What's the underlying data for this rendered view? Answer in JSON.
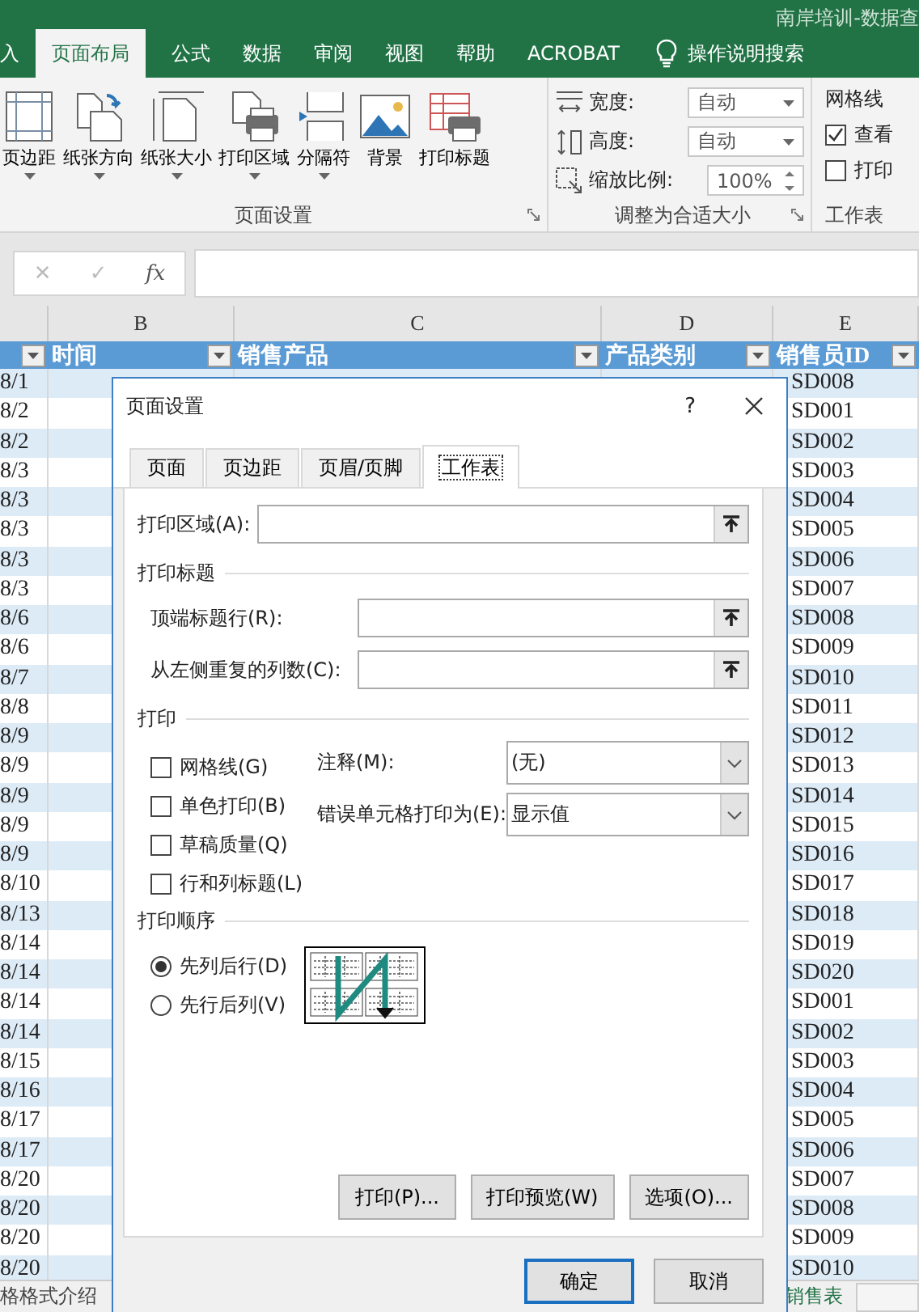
{
  "window": {
    "title": "南岸培训-数据查"
  },
  "ribbon_tabs": [
    {
      "label": "入",
      "selected": false
    },
    {
      "label": "页面布局",
      "selected": true
    },
    {
      "label": "公式",
      "selected": false
    },
    {
      "label": "数据",
      "selected": false
    },
    {
      "label": "审阅",
      "selected": false
    },
    {
      "label": "视图",
      "selected": false
    },
    {
      "label": "帮助",
      "selected": false
    },
    {
      "label": "ACROBAT",
      "selected": false
    }
  ],
  "tell_me": {
    "label": "操作说明搜索"
  },
  "page_setup_group": {
    "label": "页面设置",
    "buttons": [
      {
        "kind": "margins",
        "label": "页边距",
        "dropdown": true
      },
      {
        "kind": "orientation",
        "label": "纸张方向",
        "dropdown": true
      },
      {
        "kind": "size",
        "label": "纸张大小",
        "dropdown": true
      },
      {
        "kind": "print_area",
        "label": "打印区域",
        "dropdown": true
      },
      {
        "kind": "breaks",
        "label": "分隔符",
        "dropdown": true
      },
      {
        "kind": "background",
        "label": "背景",
        "dropdown": false
      },
      {
        "kind": "print_titles",
        "label": "打印标题",
        "dropdown": false
      }
    ]
  },
  "scale_group": {
    "label": "调整为合适大小",
    "rows": [
      {
        "kind": "width",
        "label": "宽度:",
        "value": "自动"
      },
      {
        "kind": "height",
        "label": "高度:",
        "value": "自动"
      },
      {
        "kind": "scale",
        "label": "缩放比例:",
        "value": "100%"
      }
    ]
  },
  "sheet_options_group": {
    "label": "工作表",
    "gridlines": {
      "title": "网格线",
      "options": [
        {
          "label": "查看",
          "checked": true
        },
        {
          "label": "打印",
          "checked": false
        }
      ]
    }
  },
  "formula_bar": {
    "cancel": "✕",
    "enter": "✓",
    "function": "fx"
  },
  "sheet": {
    "column_letters": [
      "B",
      "C",
      "D",
      "E"
    ],
    "headers": [
      "时间",
      "销售产品",
      "产品类别",
      "销售员ID"
    ],
    "rows": [
      {
        "column_a": "8/1",
        "salesperson_id": "SD008"
      },
      {
        "column_a": "8/2",
        "salesperson_id": "SD001"
      },
      {
        "column_a": "8/2",
        "salesperson_id": "SD002"
      },
      {
        "column_a": "8/3",
        "salesperson_id": "SD003"
      },
      {
        "column_a": "8/3",
        "salesperson_id": "SD004"
      },
      {
        "column_a": "8/3",
        "salesperson_id": "SD005"
      },
      {
        "column_a": "8/3",
        "salesperson_id": "SD006"
      },
      {
        "column_a": "8/3",
        "salesperson_id": "SD007"
      },
      {
        "column_a": "8/6",
        "salesperson_id": "SD008"
      },
      {
        "column_a": "8/6",
        "salesperson_id": "SD009"
      },
      {
        "column_a": "8/7",
        "salesperson_id": "SD010"
      },
      {
        "column_a": "8/8",
        "salesperson_id": "SD011"
      },
      {
        "column_a": "8/9",
        "salesperson_id": "SD012"
      },
      {
        "column_a": "8/9",
        "salesperson_id": "SD013"
      },
      {
        "column_a": "8/9",
        "salesperson_id": "SD014"
      },
      {
        "column_a": "8/9",
        "salesperson_id": "SD015"
      },
      {
        "column_a": "8/9",
        "salesperson_id": "SD016"
      },
      {
        "column_a": "8/10",
        "salesperson_id": "SD017"
      },
      {
        "column_a": "8/13",
        "salesperson_id": "SD018"
      },
      {
        "column_a": "8/14",
        "salesperson_id": "SD019"
      },
      {
        "column_a": "8/14",
        "salesperson_id": "SD020"
      },
      {
        "column_a": "8/14",
        "salesperson_id": "SD001"
      },
      {
        "column_a": "8/14",
        "salesperson_id": "SD002"
      },
      {
        "column_a": "8/15",
        "salesperson_id": "SD003"
      },
      {
        "column_a": "8/16",
        "salesperson_id": "SD004"
      },
      {
        "column_a": "8/17",
        "salesperson_id": "SD005"
      },
      {
        "column_a": "8/17",
        "salesperson_id": "SD006"
      },
      {
        "column_a": "8/20",
        "salesperson_id": "SD007"
      },
      {
        "column_a": "8/20",
        "salesperson_id": "SD008"
      },
      {
        "column_a": "8/20",
        "salesperson_id": "SD009"
      },
      {
        "column_a": "8/20",
        "salesperson_id": "SD010"
      }
    ]
  },
  "sheet_tabs": [
    {
      "label": "格格式介绍",
      "selected": false
    },
    {
      "label": "销售表",
      "selected": true
    }
  ],
  "dialog": {
    "title": "页面设置",
    "help": "?",
    "tabs": [
      {
        "label": "页面",
        "selected": false
      },
      {
        "label": "页边距",
        "selected": false
      },
      {
        "label": "页眉/页脚",
        "selected": false
      },
      {
        "label": "工作表",
        "selected": true
      }
    ],
    "print_area": {
      "label": "打印区域(A):"
    },
    "print_titles": {
      "title": "打印标题",
      "fields": [
        {
          "label": "顶端标题行(R):"
        },
        {
          "label": "从左侧重复的列数(C):"
        }
      ]
    },
    "print": {
      "title": "打印",
      "checkboxes": [
        {
          "label": "网格线(G)",
          "checked": false
        },
        {
          "label": "单色打印(B)",
          "checked": false
        },
        {
          "label": "草稿质量(Q)",
          "checked": false
        },
        {
          "label": "行和列标题(L)",
          "checked": false
        }
      ],
      "selects": [
        {
          "label": "注释(M):",
          "value": "(无)"
        },
        {
          "label": "错误单元格打印为(E):",
          "value": "显示值"
        }
      ]
    },
    "page_order": {
      "title": "打印顺序",
      "options": [
        {
          "label": "先列后行(D)",
          "selected": true
        },
        {
          "label": "先行后列(V)",
          "selected": false
        }
      ]
    },
    "buttons": [
      "打印(P)...",
      "打印预览(W)",
      "选项(O)..."
    ],
    "footer_buttons": [
      {
        "label": "确定",
        "default": true
      },
      {
        "label": "取消",
        "default": false
      }
    ]
  }
}
